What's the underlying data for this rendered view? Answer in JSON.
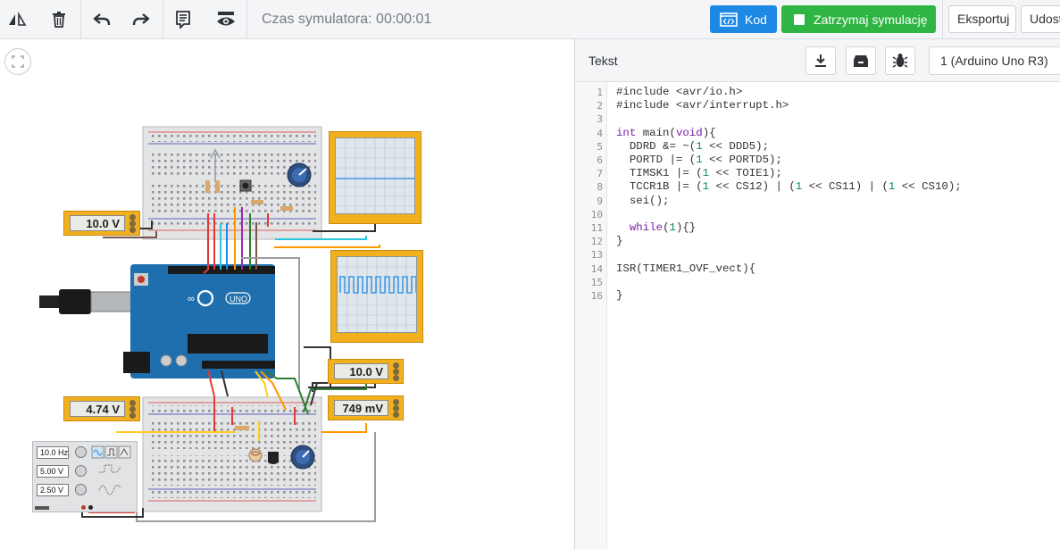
{
  "toolbar": {
    "sim_time": "Czas symulatora: 00:00:01",
    "code_label": "Kod",
    "stop_label": "Zatrzymaj symulację",
    "export_label": "Eksportuj",
    "share_label": "Udostępnij"
  },
  "code_panel": {
    "tab_label": "Tekst",
    "device": "1 (Arduino Uno R3)",
    "lines": [
      {
        "n": "1",
        "text": "#include <avr/io.h>"
      },
      {
        "n": "2",
        "text": "#include <avr/interrupt.h>"
      },
      {
        "n": "3",
        "text": ""
      },
      {
        "n": "4",
        "text": "int main(void){"
      },
      {
        "n": "5",
        "text": "  DDRD &= ~(1 << DDD5);"
      },
      {
        "n": "6",
        "text": "  PORTD |= (1 << PORTD5);"
      },
      {
        "n": "7",
        "text": "  TIMSK1 |= (1 << TOIE1);"
      },
      {
        "n": "8",
        "text": "  TCCR1B |= (1 << CS12) | (1 << CS11) | (1 << CS10);"
      },
      {
        "n": "9",
        "text": "  sei();"
      },
      {
        "n": "10",
        "text": ""
      },
      {
        "n": "11",
        "text": "  while(1){}"
      },
      {
        "n": "12",
        "text": "}"
      },
      {
        "n": "13",
        "text": ""
      },
      {
        "n": "14",
        "text": "ISR(TIMER1_OVF_vect){"
      },
      {
        "n": "15",
        "text": ""
      },
      {
        "n": "16",
        "text": "}"
      }
    ]
  },
  "circuit": {
    "multimeters": [
      {
        "id": "mm1",
        "value": "10.0 V"
      },
      {
        "id": "mm2",
        "value": "10.0 V"
      },
      {
        "id": "mm3",
        "value": "4.74 V"
      },
      {
        "id": "mm4",
        "value": "749 mV"
      }
    ],
    "arduino_label": "UNO",
    "function_generator": {
      "frequency": "10.0 Hz",
      "amplitude": "5.00 V",
      "offset": "2.50 V"
    }
  },
  "colors": {
    "kod_button": "#1e88e5",
    "stop_button": "#2eb543",
    "arduino_board": "#1f6fae",
    "instrument": "#f2b01e"
  },
  "icons": [
    "flip-icon",
    "trash-icon",
    "undo-icon",
    "redo-icon",
    "notes-icon",
    "visibility-icon",
    "code-icon",
    "stop-icon",
    "fit-view-icon",
    "download-icon",
    "library-icon",
    "debug-icon"
  ]
}
